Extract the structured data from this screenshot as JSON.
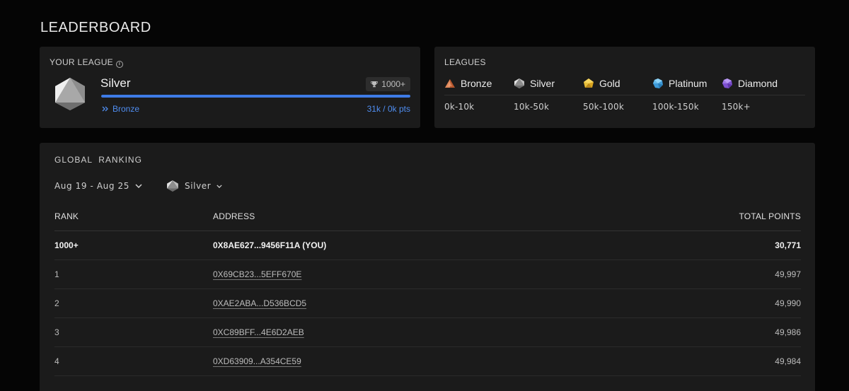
{
  "page": {
    "title": "LEADERBOARD"
  },
  "your_league": {
    "label": "YOUR LEAGUE",
    "info_icon": "info-icon",
    "league_name": "Silver",
    "rank_badge": "1000+",
    "progress_fraction": 1.0,
    "progress_color": "#3e7be6",
    "next_league_label": "Bronze",
    "points_text": "31k / 0k pts"
  },
  "leagues": {
    "label": "LEAGUES",
    "items": [
      {
        "name": "Bronze",
        "range": "0k-10k",
        "icon": "bronze-gem-icon",
        "color": "#c4653a"
      },
      {
        "name": "Silver",
        "range": "10k-50k",
        "icon": "silver-gem-icon",
        "color": "#9a9a9a"
      },
      {
        "name": "Gold",
        "range": "50k-100k",
        "icon": "gold-gem-icon",
        "color": "#e0b32a"
      },
      {
        "name": "Platinum",
        "range": "100k-150k",
        "icon": "platinum-gem-icon",
        "color": "#4aa8e0"
      },
      {
        "name": "Diamond",
        "range": "150k+",
        "icon": "diamond-gem-icon",
        "color": "#8a5ad8"
      }
    ]
  },
  "ranking": {
    "title": "GLOBAL  RANKING",
    "date_filter": "Aug 19 - Aug 25",
    "league_filter": "Silver",
    "columns": {
      "rank": "RANK",
      "address": "ADDRESS",
      "points": "TOTAL POINTS"
    },
    "you_row": {
      "rank": "1000+",
      "address": "0X8AE627...9456F11A (YOU)",
      "points": "30,771"
    },
    "rows": [
      {
        "rank": "1",
        "address": "0X69CB23...5EFF670E",
        "points": "49,997"
      },
      {
        "rank": "2",
        "address": "0XAE2ABA...D536BCD5",
        "points": "49,990"
      },
      {
        "rank": "3",
        "address": "0XC89BFF...4E6D2AEB",
        "points": "49,986"
      },
      {
        "rank": "4",
        "address": "0XD63909...A354CE59",
        "points": "49,984"
      }
    ]
  }
}
